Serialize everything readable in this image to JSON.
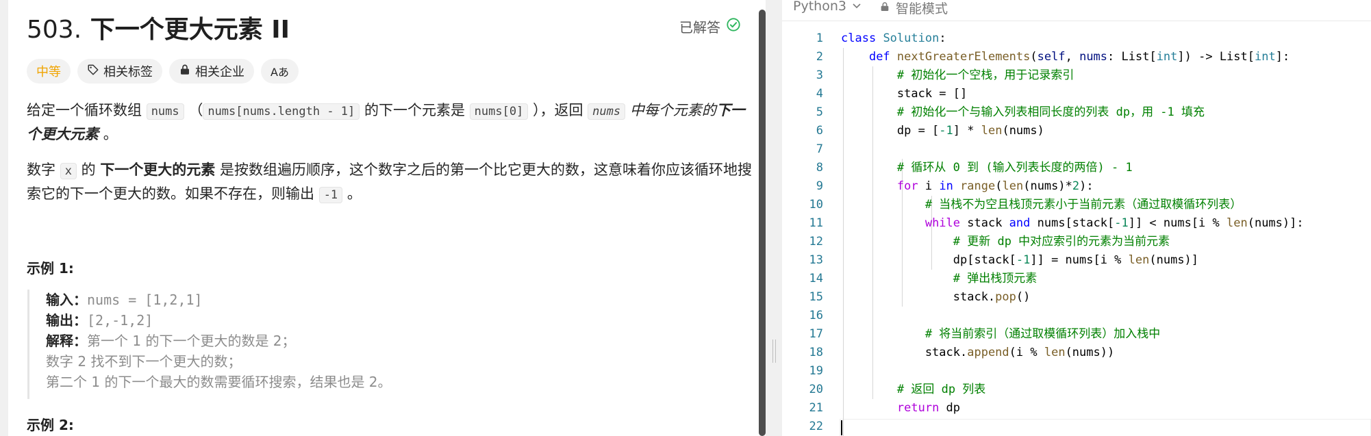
{
  "problem": {
    "number": "503.",
    "title": "下一个更大元素 II",
    "status": "已解答",
    "difficulty": "中等",
    "tags": [
      "相关标签",
      "相关企业"
    ],
    "translate_label": "Aあ"
  },
  "description": {
    "p1_a": "给定一个循环数组",
    "p1_nums": "nums",
    "p1_b": "（",
    "p1_code2": "nums[nums.length - 1]",
    "p1_c": "的下一个元素是",
    "p1_code3": "nums[0]",
    "p1_d": "），返回",
    "p1_code4": "nums",
    "p1_e": "中每个元素的",
    "p1_f": "下一个更大元素",
    "p1_g": "。",
    "p2_a": "数字",
    "p2_x": "x",
    "p2_b": "的",
    "p2_bold": "下一个更大的元素",
    "p2_c": "是按数组遍历顺序，这个数字之后的第一个比它更大的数，这意味着你应该循环地搜索它的下一个更大的数。如果不存在，则输出",
    "p2_neg": "-1",
    "p2_d": "。"
  },
  "examples": {
    "ex1_title": "示例 1:",
    "input_label": "输入：",
    "input_value": "nums = [1,2,1]",
    "output_label": "输出：",
    "output_value": "[2,-1,2]",
    "explain_label": "解释：",
    "explain_1": "第一个 1 的下一个更大的数是 2；",
    "explain_2": "数字 2 找不到下一个更大的数；",
    "explain_3": "第二个 1 的下一个最大的数需要循环搜索，结果也是 2。",
    "ex2_title": "示例 2:"
  },
  "editor": {
    "language": "Python3",
    "mode": "智能模式",
    "line_numbers": [
      "1",
      "2",
      "3",
      "4",
      "5",
      "6",
      "7",
      "8",
      "9",
      "10",
      "11",
      "12",
      "13",
      "14",
      "15",
      "16",
      "17",
      "18",
      "19",
      "20",
      "21",
      "22"
    ]
  },
  "colors": {
    "difficulty": "#f0a400",
    "solved_check": "#2db55d",
    "keyword": "#0000ff",
    "comment": "#008000",
    "line_number": "#237893"
  }
}
